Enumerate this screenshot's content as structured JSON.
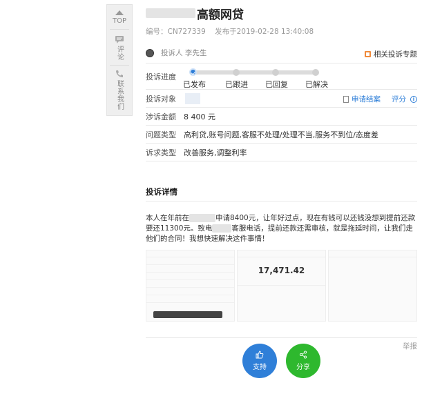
{
  "sidebar": {
    "top_label": "TOP",
    "comment_label": "评论",
    "contact_label": "联系我们"
  },
  "header": {
    "title": "高额网贷",
    "id_text": "编号：CN727339",
    "published_text": "发布于2019-02-28 13:40:08"
  },
  "complainant": {
    "text": "投诉人 李先生",
    "related_topic": "相关投诉专题"
  },
  "progress": {
    "label": "投诉进度",
    "steps": [
      "已发布",
      "已跟进",
      "已回复",
      "已解决"
    ],
    "current_step": 1
  },
  "fields": {
    "target_label": "投诉对象",
    "apply_close": "申请结案",
    "rate": "评分",
    "amount_label": "涉诉金额",
    "amount_value": "8 400 元",
    "issue_label": "问题类型",
    "issue_value": "高利贷,账号问题,客服不处理/处理不当,服务不到位/态度差",
    "demand_label": "诉求类型",
    "demand_value": "改善服务,调整利率"
  },
  "detail": {
    "title": "投诉详情",
    "text_part1": "本人在年前在",
    "text_part2": "申请8400元，让年好过点，现在有钱可以还钱没想到提前还款要还11300元。致电",
    "text_part3": "客服电话，提前还款还需审核，就是拖延时间，让我们走他们的合同！我想快速解决这件事情！"
  },
  "screenshots": {
    "shot2_amount": "17,471.42"
  },
  "footer": {
    "report": "举报",
    "support": "支持",
    "share": "分享"
  },
  "colors": {
    "accent_blue": "#2f7fd8",
    "share_green": "#2eb82e",
    "related_orange": "#f08a3a"
  }
}
